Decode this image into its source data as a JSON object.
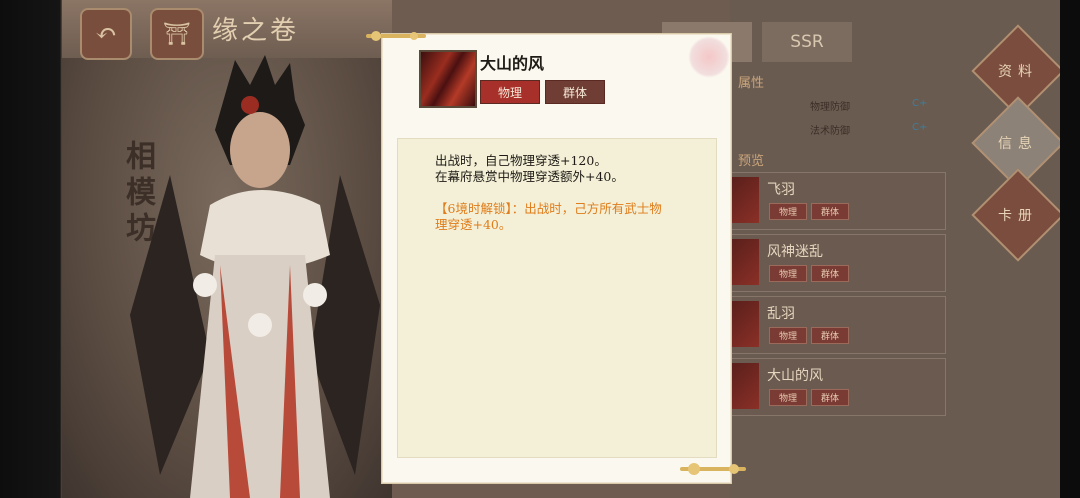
{
  "header": {
    "back_icon": "back-arrow-icon",
    "home_icon": "shrine-icon",
    "title": "缘之卷"
  },
  "character": {
    "location_title": "相模坊"
  },
  "tabs": [
    {
      "label": ""
    },
    {
      "label": "SSR"
    }
  ],
  "right_menu": [
    {
      "label": "资料"
    },
    {
      "label": "信息"
    },
    {
      "label": "卡册"
    }
  ],
  "attributes": {
    "section_label": "属性",
    "rows": [
      {
        "label": "物理防御",
        "grade": "C+"
      },
      {
        "label": "法术防御",
        "grade": "C+"
      }
    ]
  },
  "skill_list": {
    "section_label": "预览",
    "items": [
      {
        "name": "飞羽",
        "tags": [
          "物理",
          "群体"
        ]
      },
      {
        "name": "风神迷乱",
        "tags": [
          "物理",
          "群体"
        ]
      },
      {
        "name": "乱羽",
        "tags": [
          "物理",
          "群体"
        ]
      },
      {
        "name": "大山的风",
        "tags": [
          "物理",
          "群体"
        ]
      }
    ]
  },
  "popup": {
    "skill_name": "大山的风",
    "tag_physical": "物理",
    "tag_group": "群体",
    "desc_line1": "出战时，自己物理穿透+120。",
    "desc_line2": "在幕府悬赏中物理穿透额外+40。",
    "unlock_line1": "【6境时解锁】：出战时，己方所有武士物",
    "unlock_line2": "理穿透+40。"
  },
  "colors": {
    "tag_physical": "#a7302a",
    "tag_group": "#6f3d33",
    "unlock_text": "#e07c1a",
    "desc_bg": "#f3f0d7"
  }
}
